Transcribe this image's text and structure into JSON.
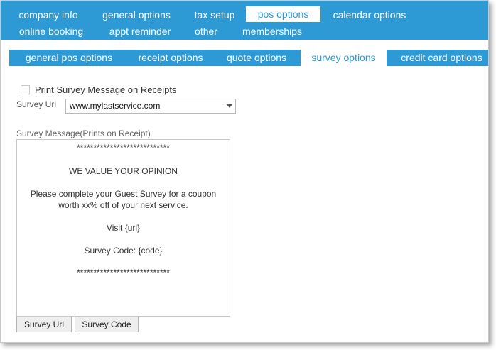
{
  "top_tabs": {
    "row1": [
      "company info",
      "general options",
      "tax setup",
      "pos options",
      "calendar options"
    ],
    "row2": [
      "online booking",
      "appt reminder",
      "other",
      "memberships"
    ],
    "active": "pos options"
  },
  "sub_tabs": {
    "items": [
      "general pos options",
      "receipt options",
      "quote options",
      "survey options",
      "credit card options"
    ],
    "active": "survey options"
  },
  "form": {
    "print_checkbox_label": "Print Survey Message on Receipts",
    "print_checkbox_checked": false,
    "survey_url_label": "Survey Url",
    "survey_url_value": "www.mylastservice.com",
    "survey_message_label": "Survey Message(Prints on Receipt)",
    "message_lines": [
      "****************************",
      "WE VALUE YOUR OPINION",
      "Please complete your Guest Survey for a coupon",
      "worth xx% off of your next service.",
      "Visit {url}",
      "Survey Code: {code}",
      "****************************"
    ]
  },
  "buttons": {
    "survey_url": "Survey Url",
    "survey_code": "Survey Code"
  },
  "colors": {
    "accent": "#2d9ad6",
    "tab_text": "#ffffff"
  },
  "icons": {
    "dropdown": "chevron-down-icon"
  }
}
